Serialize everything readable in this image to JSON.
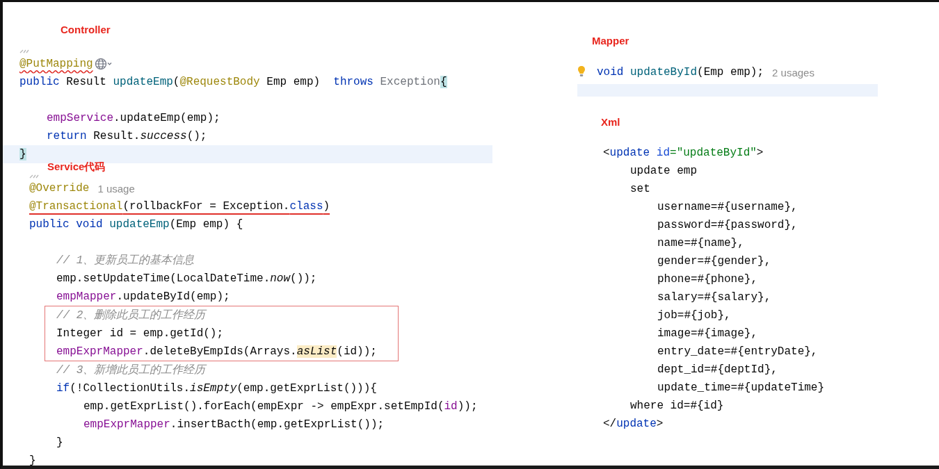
{
  "left_sections": [
    {
      "title": "Controller",
      "inlay": true,
      "lines": [
        {
          "segments": [
            {
              "text": "@PutMapping",
              "kind": "ann",
              "squiggly": true
            }
          ],
          "endpoint": true
        },
        {
          "segments": [
            {
              "text": "public",
              "kind": "kw"
            },
            {
              "text": " Result ",
              "kind": "plain"
            },
            {
              "text": "updateEmp",
              "kind": "decl"
            },
            {
              "text": "(",
              "kind": "plain"
            },
            {
              "text": "@RequestBody",
              "kind": "ann"
            },
            {
              "text": " Emp emp)  ",
              "kind": "plain"
            },
            {
              "text": "throws",
              "kind": "kw"
            },
            {
              "text": " Exception",
              "kind": "gray"
            },
            {
              "text": "{",
              "kind": "plain",
              "bracket_match": true
            }
          ],
          "children": [
            {
              "kind": "blank"
            },
            {
              "segments": [
                {
                  "text": "empService",
                  "kind": "field"
                },
                {
                  "text": ".updateEmp(emp);",
                  "kind": "plain"
                }
              ]
            },
            {
              "segments": [
                {
                  "text": "return",
                  "kind": "kw"
                },
                {
                  "text": " Result.",
                  "kind": "plain"
                },
                {
                  "text": "success",
                  "kind": "static"
                },
                {
                  "text": "();",
                  "kind": "plain"
                }
              ]
            }
          ]
        },
        {
          "segments": [
            {
              "text": "}",
              "kind": "plain",
              "bracket_match": true
            }
          ],
          "current": true
        }
      ]
    },
    {
      "title": "Service代码",
      "inlay": true,
      "lines": [
        {
          "segments": [
            {
              "text": "@Override",
              "kind": "ann"
            }
          ],
          "hint": "1 usage"
        },
        {
          "segments": [
            {
              "text": "@Transactional",
              "kind": "ann"
            },
            {
              "text": "(rollbackFor = Exception.",
              "kind": "plain"
            },
            {
              "text": "class",
              "kind": "kw"
            },
            {
              "text": ")",
              "kind": "plain"
            }
          ],
          "underlined": true
        },
        {
          "segments": [
            {
              "text": "public void",
              "kind": "kw"
            },
            {
              "text": " updateEmp",
              "kind": "decl"
            },
            {
              "text": "(Emp emp) {",
              "kind": "plain"
            }
          ],
          "children": [
            {
              "kind": "blank"
            },
            {
              "segments": [
                {
                  "text": "// 1、更新员工的基本信息",
                  "kind": "comment"
                }
              ]
            },
            {
              "segments": [
                {
                  "text": "emp.setUpdateTime(LocalDateTime.",
                  "kind": "plain"
                },
                {
                  "text": "now",
                  "kind": "static"
                },
                {
                  "text": "());",
                  "kind": "plain"
                }
              ]
            },
            {
              "segments": [
                {
                  "text": "empMapper",
                  "kind": "field"
                },
                {
                  "text": ".updateById(emp);",
                  "kind": "plain"
                }
              ]
            },
            {
              "kind": "box",
              "children": [
                {
                  "segments": [
                    {
                      "text": "// 2、删除此员工的工作经历",
                      "kind": "comment"
                    }
                  ]
                },
                {
                  "segments": [
                    {
                      "text": "Integer id = emp.getId();",
                      "kind": "plain"
                    }
                  ]
                },
                {
                  "segments": [
                    {
                      "text": "empExprMapper",
                      "kind": "field"
                    },
                    {
                      "text": ".deleteByEmpIds(Arrays.",
                      "kind": "plain"
                    },
                    {
                      "text": "asList",
                      "kind": "static",
                      "usage_highlight": true
                    },
                    {
                      "text": "(id));",
                      "kind": "plain"
                    }
                  ]
                }
              ]
            },
            {
              "segments": [
                {
                  "text": "// 3、新增此员工的工作经历",
                  "kind": "comment"
                }
              ]
            },
            {
              "segments": [
                {
                  "text": "if",
                  "kind": "kw"
                },
                {
                  "text": "(!CollectionUtils.",
                  "kind": "plain"
                },
                {
                  "text": "isEmpty",
                  "kind": "static"
                },
                {
                  "text": "(emp.getExprList())){",
                  "kind": "plain"
                }
              ],
              "children": [
                {
                  "segments": [
                    {
                      "text": "emp.getExprList().forEach(empExpr -> empExpr.setEmpId(",
                      "kind": "plain"
                    },
                    {
                      "text": "id",
                      "kind": "field"
                    },
                    {
                      "text": "));",
                      "kind": "plain"
                    }
                  ]
                },
                {
                  "segments": [
                    {
                      "text": "empExprMapper",
                      "kind": "field"
                    },
                    {
                      "text": ".insertBacth(emp.getExprList());",
                      "kind": "plain"
                    }
                  ]
                }
              ]
            },
            {
              "segments": [
                {
                  "text": "}",
                  "kind": "plain"
                }
              ]
            }
          ]
        },
        {
          "segments": [
            {
              "text": "}",
              "kind": "plain"
            }
          ]
        }
      ]
    }
  ],
  "right_sections": [
    {
      "title": "Mapper",
      "inlay": false,
      "lines": [
        {
          "segments": [
            {
              "text": "void",
              "kind": "kw"
            },
            {
              "text": " updateById",
              "kind": "decl"
            },
            {
              "text": "(Emp emp);",
              "kind": "plain"
            }
          ],
          "hint": "2 usages",
          "bulb": true
        },
        {
          "kind": "blank",
          "current": true
        }
      ]
    },
    {
      "title": "Xml",
      "inlay": false,
      "lines": [
        {
          "segments": [
            {
              "text": "<",
              "kind": "plain"
            },
            {
              "text": "update",
              "kind": "tag"
            },
            {
              "text": " id",
              "kind": "attr"
            },
            {
              "text": "=\"updateById\"",
              "kind": "str"
            },
            {
              "text": ">",
              "kind": "plain"
            }
          ],
          "children": [
            {
              "segments": [
                {
                  "text": "update emp",
                  "kind": "plain"
                }
              ]
            },
            {
              "segments": [
                {
                  "text": "set",
                  "kind": "plain"
                }
              ],
              "children": [
                {
                  "segments": [
                    {
                      "text": "username=#{username},",
                      "kind": "plain"
                    }
                  ]
                },
                {
                  "segments": [
                    {
                      "text": "password=#{password},",
                      "kind": "plain"
                    }
                  ]
                },
                {
                  "segments": [
                    {
                      "text": "name=#{name},",
                      "kind": "plain"
                    }
                  ]
                },
                {
                  "segments": [
                    {
                      "text": "gender=#{gender},",
                      "kind": "plain"
                    }
                  ]
                },
                {
                  "segments": [
                    {
                      "text": "phone=#{phone},",
                      "kind": "plain"
                    }
                  ]
                },
                {
                  "segments": [
                    {
                      "text": "salary=#{salary},",
                      "kind": "plain"
                    }
                  ]
                },
                {
                  "segments": [
                    {
                      "text": "job=#{job},",
                      "kind": "plain"
                    }
                  ]
                },
                {
                  "segments": [
                    {
                      "text": "image=#{image},",
                      "kind": "plain"
                    }
                  ]
                },
                {
                  "segments": [
                    {
                      "text": "entry_date=#{entryDate},",
                      "kind": "plain"
                    }
                  ]
                },
                {
                  "segments": [
                    {
                      "text": "dept_id=#{deptId},",
                      "kind": "plain"
                    }
                  ]
                },
                {
                  "segments": [
                    {
                      "text": "update_time=#{updateTime}",
                      "kind": "plain"
                    }
                  ]
                }
              ]
            },
            {
              "segments": [
                {
                  "text": "where id=#{id}",
                  "kind": "plain"
                }
              ]
            }
          ]
        },
        {
          "segments": [
            {
              "text": "</",
              "kind": "plain"
            },
            {
              "text": "update",
              "kind": "tag"
            },
            {
              "text": ">",
              "kind": "plain"
            }
          ]
        }
      ]
    }
  ]
}
